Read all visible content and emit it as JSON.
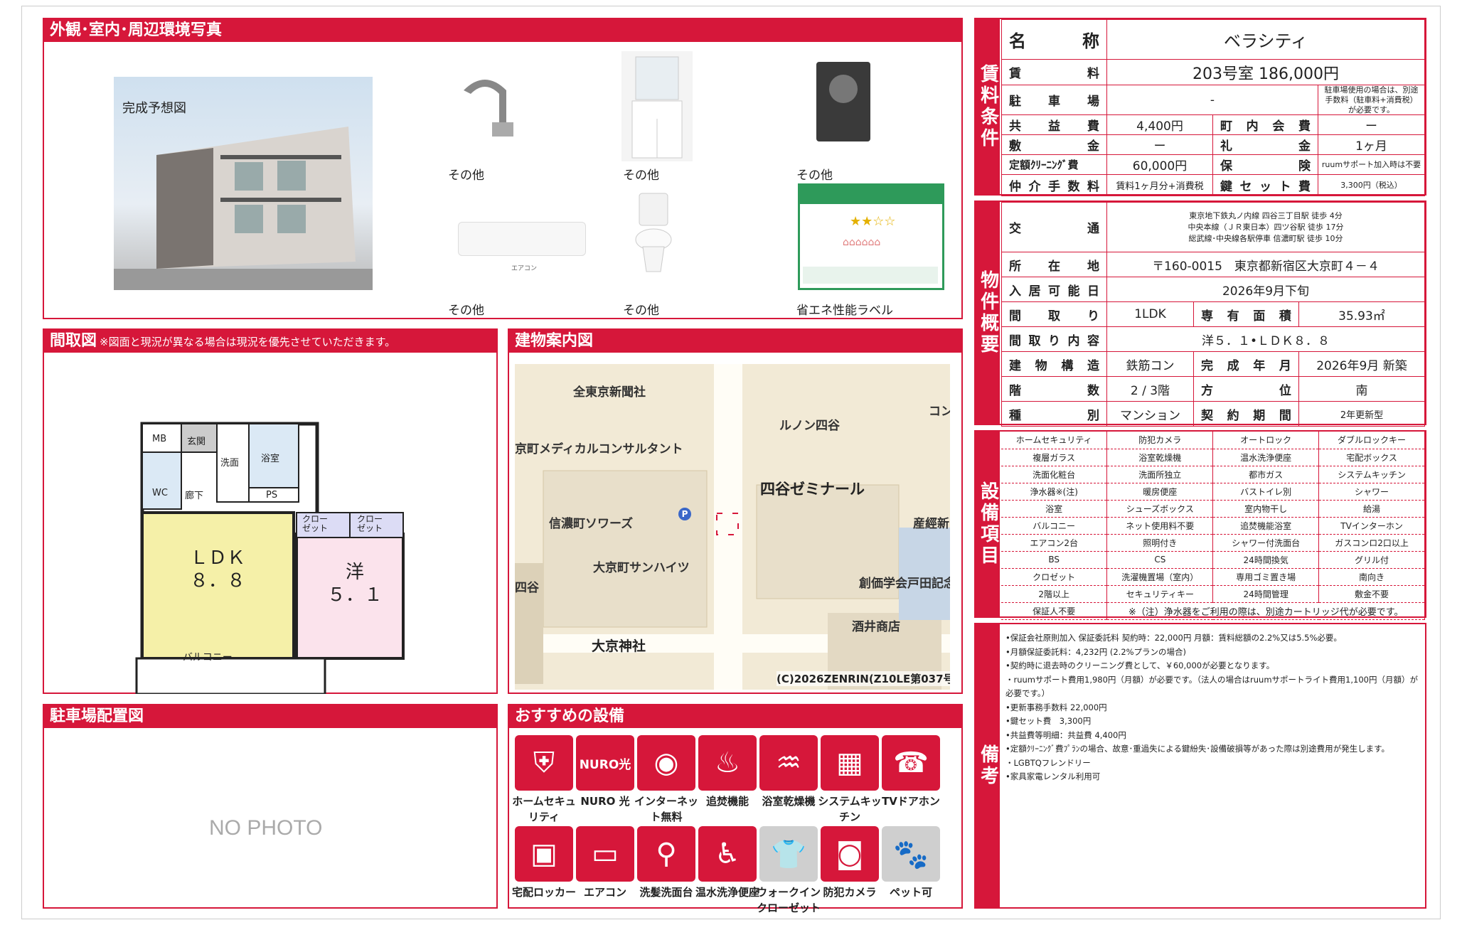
{
  "photos": {
    "title": "外観･室内･周辺環境写真",
    "main_caption": "完成予想図",
    "captions": [
      "その他",
      "その他",
      "その他",
      "その他",
      "その他",
      "省エネ性能ラベル"
    ],
    "aircon_text": "エアコン"
  },
  "floorplan": {
    "title": "間取図",
    "note": "※図面と現況が異なる場合は現況を優先させていただきます。",
    "rooms": {
      "mb": "MB",
      "genkan": "玄関",
      "wc": "WC",
      "rouka": "廊下",
      "senmen": "洗面",
      "yokushitsu": "浴室",
      "ps": "PS",
      "closet1": "クロー\nゼット",
      "closet2": "クロー\nゼット",
      "ldk": "ＬＤＫ\n８．８",
      "you": "洋\n５．１",
      "balcony": "バルコニー"
    }
  },
  "map": {
    "title": "建物案内図",
    "labels": [
      "全東京新聞社",
      "京町メディカルコンサルタント",
      "ルノン四谷",
      "四谷ゼミナール",
      "信濃町ソワーズ",
      "大京町サンハイツ",
      "四谷",
      "大京神社",
      "創価学会戸田記念",
      "酒井商店",
      "産經新",
      "コン"
    ],
    "copyright": "(C)2026ZENRIN(Z10LE第037号)"
  },
  "parking": {
    "title": "駐車場配置図",
    "no_photo": "NO PHOTO"
  },
  "recommend": {
    "title": "おすすめの設備",
    "items": [
      {
        "label": "ホームセキュリティ",
        "icon": "shield-icon"
      },
      {
        "label": "NURO 光",
        "icon": "nuro-icon"
      },
      {
        "label": "インターネット無料",
        "icon": "wifi-icon"
      },
      {
        "label": "追焚機能",
        "icon": "bathtub-icon"
      },
      {
        "label": "浴室乾燥機",
        "icon": "bath-dryer-icon"
      },
      {
        "label": "システムキッチン",
        "icon": "kitchen-icon"
      },
      {
        "label": "TVドアホン",
        "icon": "doorphone-icon"
      },
      {
        "label": "宅配ロッカー",
        "icon": "locker-icon"
      },
      {
        "label": "エアコン",
        "icon": "aircon-icon"
      },
      {
        "label": "洗髪洗面台",
        "icon": "washbasin-icon"
      },
      {
        "label": "温水洗浄便座",
        "icon": "toilet-icon"
      },
      {
        "label": "ウォークインクローゼット",
        "icon": "closet-icon"
      },
      {
        "label": "防犯カメラ",
        "icon": "camera-icon"
      },
      {
        "label": "ペット可",
        "icon": "paw-icon"
      }
    ],
    "nuro_text": "NURO光"
  },
  "conditions": {
    "label": "賃料条件",
    "name_key": "名称",
    "name": "ベラシティ",
    "rent_key": "賃料",
    "rent": "203号室 186,000円",
    "parking_key": "駐車場",
    "parking": "-",
    "parking_note": "駐車場使用の場合は、別途手数料（駐車料+消費税）が必要です。",
    "kyoeki_key": "共益費",
    "kyoeki": "4,400円",
    "chonai_key": "町内会費",
    "chonai": "ー",
    "shiki_key": "敷金",
    "shiki": "ー",
    "rei_key": "礼金",
    "rei": "1ヶ月",
    "cleaning_key": "定額ｸﾘｰﾆﾝｸﾞ費",
    "cleaning": "60,000円",
    "hoken_key": "保険",
    "hoken": "ruumサポート加入時は不要",
    "chukai_key": "仲介手数料",
    "chukai": "賃料1ヶ月分+消費税",
    "kagi_key": "鍵セット費",
    "kagi": "3,300円（税込）"
  },
  "overview": {
    "label": "物件概要",
    "kotsu_key": "交通",
    "kotsu": [
      "東京地下鉄丸ノ内線 四谷三丁目駅 徒歩 4分",
      "中央本線（ＪＲ東日本）四ツ谷駅 徒歩 17分",
      "総武線･中央線各駅停車 信濃町駅 徒歩 10分"
    ],
    "address_key": "所在地",
    "address": "〒160-0015　東京都新宿区大京町４－４",
    "move_key": "入居可能日",
    "move": "2026年9月下旬",
    "madori_key": "間取り",
    "madori": "1LDK",
    "area_key": "専有面積",
    "area": "35.93㎡",
    "naiyo_key": "間取り内容",
    "naiyo": "洋５．１•ＬＤＫ８．８",
    "kozo_key": "建物構造",
    "kozo": "鉄筋コン",
    "kansei_key": "完成年月",
    "kansei": "2026年9月 新築",
    "kai_key": "階数",
    "kai": "2 / 3階",
    "hoi_key": "方位",
    "hoi": "南",
    "shubetsu_key": "種別",
    "shubetsu": "マンション",
    "keiyaku_key": "契約期間",
    "keiyaku": "2年更新型"
  },
  "equipment": {
    "label": "設備項目",
    "items": [
      "ホームセキュリティ",
      "防犯カメラ",
      "オートロック",
      "ダブルロックキー",
      "複層ガラス",
      "浴室乾燥機",
      "温水洗浄便座",
      "宅配ボックス",
      "洗面化粧台",
      "洗面所独立",
      "都市ガス",
      "システムキッチン",
      "浄水器※(注)",
      "暖房便座",
      "バストイレ別",
      "シャワー",
      "浴室",
      "シューズボックス",
      "室内物干し",
      "給湯",
      "バルコニー",
      "ネット使用料不要",
      "追焚機能浴室",
      "TVインターホン",
      "エアコン2台",
      "照明付き",
      "シャワー付洗面台",
      "ガスコンロ2口以上",
      "BS",
      "CS",
      "24時間換気",
      "グリル付",
      "クロゼット",
      "洗濯機置場（室内）",
      "専用ゴミ置き場",
      "南向き",
      "2階以上",
      "セキュリティキー",
      "24時間管理",
      "敷金不要",
      "保証人不要"
    ],
    "footnote": "※（注）浄水器をご利用の際は、別途カートリッジ代が必要です。"
  },
  "remarks": {
    "label": "備考",
    "lines": [
      "•保証会社原則加入 保証委託料 契約時：22,000円 月額：賃料総額の2.2%又は5.5%必要。",
      "•月額保証委託料：4,232円 (2.2%プランの場合)",
      "•契約時に退去時のクリーニング費として、￥60,000が必要となります。",
      "・ruumサポート費用1,980円（月額）が必要です。（法人の場合はruumサポートライト費用1,100円（月額）が必要です。）",
      "•更新事務手数料 22,000円",
      "•鍵セット費　3,300円",
      "•共益費等明細：共益費 4,400円",
      "•定額ｸﾘｰﾆﾝｸﾞ費ﾌﾟﾗﾝの場合、故意･重過失による鍵紛失･設備破損等があった際は別途費用が発生します。",
      "・LGBTQフレンドリー",
      "•家具家電レンタル利用可"
    ]
  }
}
